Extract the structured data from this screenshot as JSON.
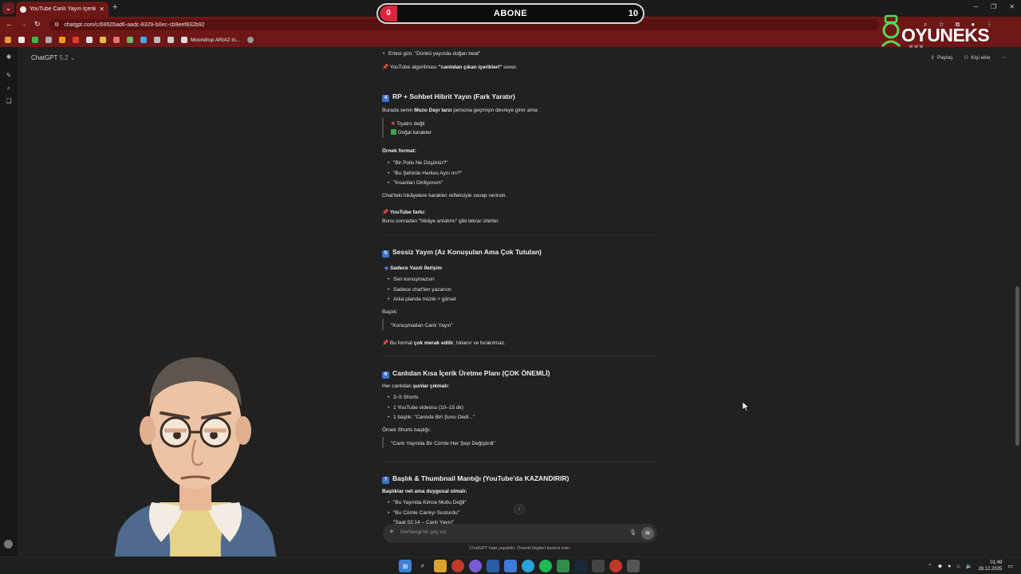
{
  "browser": {
    "tab_title": "YouTube Canlı Yayın İçerikleri",
    "url": "chatgpt.com/c/69505ad6-aadc-8329-b0ec-cb9eef832b92",
    "bookmark_label": "Moondrop ARIA2 In..."
  },
  "overlay": {
    "sub_left": "0",
    "sub_label": "ABONE",
    "sub_count": "10",
    "logo_text": "OYUNEKS",
    "logo_sub": "www"
  },
  "app": {
    "model_name": "ChatGPT",
    "model_version": "5.2",
    "share_label": "Paylaş",
    "add_person_label": "Kişi ekle",
    "composer_placeholder": "Herhangi bir şey sor",
    "disclaimer": "ChatGPT hata yapabilir. Önemli bilgileri kontrol edin."
  },
  "chat": {
    "l1": "Ertesi gün: \"Dünkü yayında doğan beat\"",
    "l2_pre": "YouTube algoritması ",
    "l2_bold": "\"canlıdan çıkan içerikleri\"",
    "l2_post": " sever.",
    "h4_num": "4",
    "h4": "RP + Sohbet Hibrit Yayın (Fark Yaratır)",
    "p4_pre": "Burada senin ",
    "p4_bold": "Muzo Dayı tarzı",
    "p4_post": " persona geçmişin devreye girer ama:",
    "q4_1": "Tiyatro değil",
    "q4_2": "Doğal karakter",
    "ex_label": "Örnek format:",
    "ex_1": "\"Bir Polis Ne Düşünür?\"",
    "ex_2": "\"Bu Şehirde Herkes Aynı mı?\"",
    "ex_3": "\"İnsanları Dinliyorum\"",
    "p4b": "Chat'teki hikâyelere karakter refleksiyle cevap verirsin.",
    "yt_diff": "YouTube farkı:",
    "yt_diff_text": "Bunu sonradan \"hikâye anlatımı\" gibi tekrar izlerler.",
    "h5_num": "5",
    "h5": "Sessiz Yayın (Az Konuşulan Ama Çok Tutulan)",
    "s5_title": "Sadece Yazılı İletişim",
    "s5_1": "Sen konuşmazsın",
    "s5_2": "Sadece chat'ten yazarsın",
    "s5_3": "Arka planda müzik + görsel",
    "title_label": "Başlık:",
    "title_q": "\"Konuşmadan Canlı Yayın\"",
    "p5_pre": "Bu format ",
    "p5_bold": "çok merak edilir",
    "p5_post": ", tıklanır ve bırakılmaz.",
    "h6_num": "6",
    "h6": "Canlıdan Kısa İçerik Üretme Planı (ÇOK ÖNEMLİ)",
    "p6_pre": "Her canlıdan ",
    "p6_bold": "şunlar çıkmalı:",
    "s6_1": "3–5 Shorts",
    "s6_2": "1 YouTube videosu (10–15 dk)",
    "s6_3_pre": "1 başlık: ",
    "s6_3_it": "\"Canlıda Biri Şunu Dedi...\"",
    "shorts_label": "Örnek Shorts başlığı:",
    "shorts_q": "\"Canlı Yayında Bir Cümle Her Şeyi Değiştirdi\"",
    "h7_num": "7",
    "h7": "Başlık & Thumbnail Mantığı (YouTube'da KAZANDIRIR)",
    "p7": "Başlıklar net ama duygusal olmalı:",
    "s7_1": "\"Bu Yayında Kimse Mutlu Değil\"",
    "s7_2": "\"Bu Cümle Canlıyı Susturdu\"",
    "s7_3": "\"Saat 02:14 – Canlı Yayın\""
  },
  "system": {
    "time": "01:49",
    "date": "28.12.2025"
  }
}
